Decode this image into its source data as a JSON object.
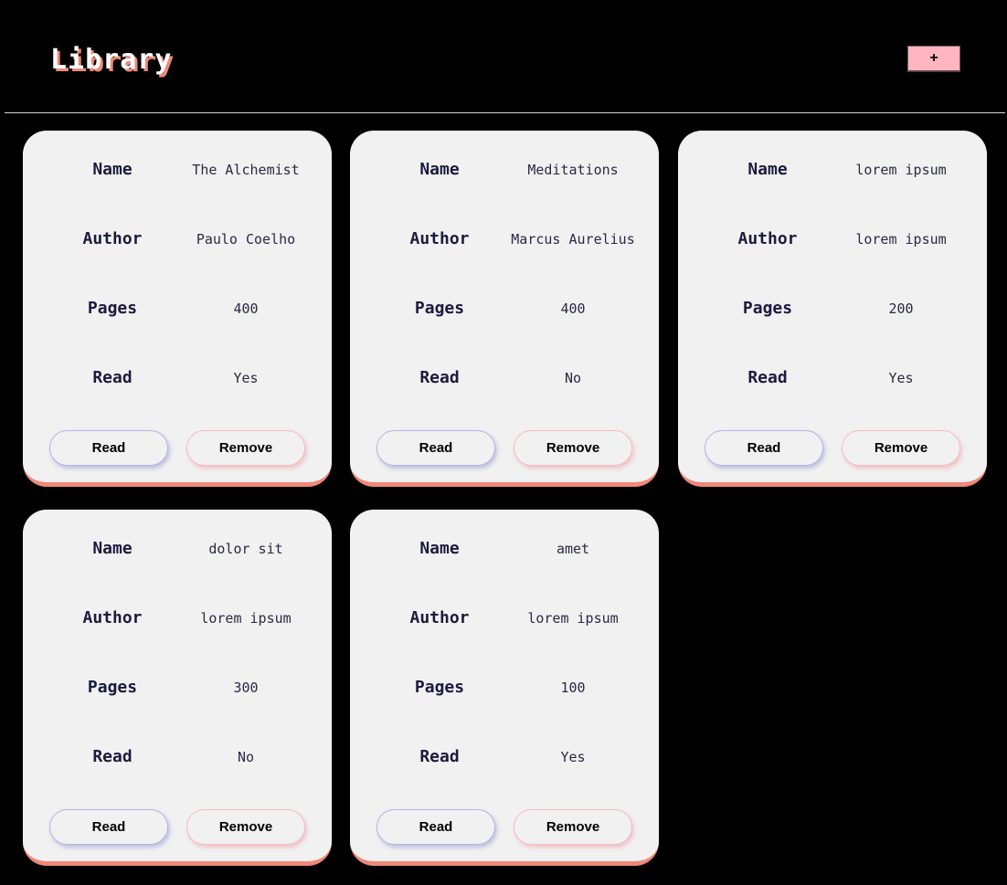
{
  "header": {
    "title": "Library",
    "add_button_label": "+"
  },
  "field_labels": {
    "name": "Name",
    "author": "Author",
    "pages": "Pages",
    "read": "Read"
  },
  "buttons": {
    "read_label": "Read",
    "remove_label": "Remove"
  },
  "books": [
    {
      "name": "The Alchemist",
      "author": "Paulo Coelho",
      "pages": "400",
      "read": "Yes"
    },
    {
      "name": "Meditations",
      "author": "Marcus Aurelius",
      "pages": "400",
      "read": "No"
    },
    {
      "name": "lorem ipsum",
      "author": "lorem ipsum",
      "pages": "200",
      "read": "Yes"
    },
    {
      "name": "dolor sit",
      "author": "lorem ipsum",
      "pages": "300",
      "read": "No"
    },
    {
      "name": "amet",
      "author": "lorem ipsum",
      "pages": "100",
      "read": "Yes"
    }
  ],
  "colors": {
    "background": "#000000",
    "card": "#f1f1f1",
    "accent": "#f08878",
    "add_button": "#ffb6c1",
    "read_button_border": "#b7b4e6",
    "remove_button_border": "#f6bcc4",
    "label_text": "#1b1b3f"
  },
  "icons": {
    "add": "plus-icon"
  }
}
